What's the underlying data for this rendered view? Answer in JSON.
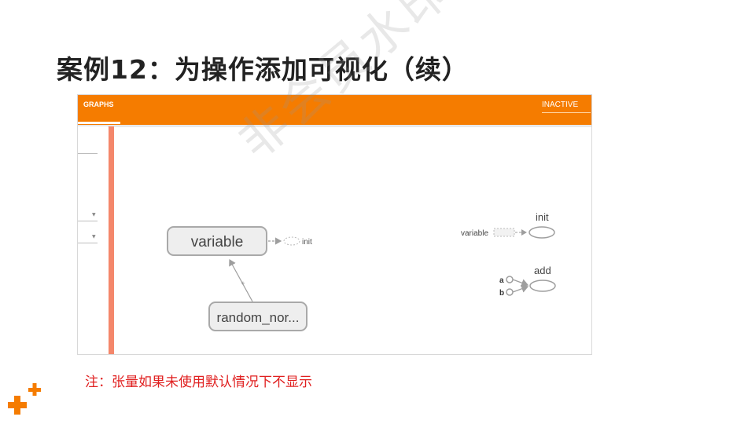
{
  "slide": {
    "title": "案例12：为操作添加可视化（续）",
    "note": "注：张量如果未使用默认情况下不显示",
    "watermark": "非会员水印"
  },
  "tensorboard": {
    "tabs": [
      "GRAPHS",
      "INACTIVE"
    ],
    "accent_color": "#f57c00",
    "nodes": {
      "variable": "variable",
      "random": "random_nor...",
      "init_inline": "init"
    },
    "legend": {
      "variable_label": "variable",
      "init_label": "init",
      "add_label": "add",
      "a_label": "a",
      "b_label": "b"
    }
  },
  "colors": {
    "note": "#e02020",
    "logo": "#f57c00"
  }
}
